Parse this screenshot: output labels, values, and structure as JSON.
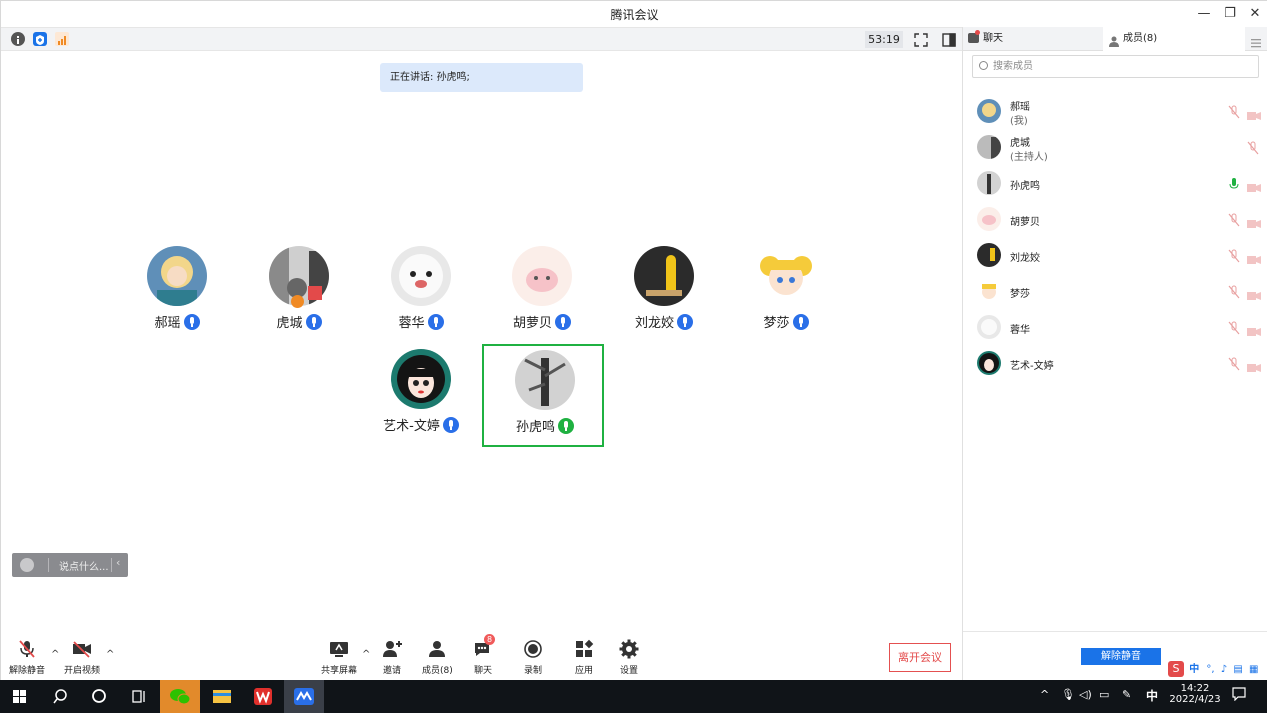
{
  "window": {
    "title": "腾讯会议",
    "controls": [
      "—",
      "❐",
      "✕"
    ]
  },
  "infobar": {
    "timer": "53:19"
  },
  "main": {
    "speaking_text": "正在讲话: 孙虎鸣;",
    "participants": [
      {
        "name": "郝瑶",
        "mic": "active"
      },
      {
        "name": "虎城",
        "mic": "active"
      },
      {
        "name": "蓉华",
        "mic": "active"
      },
      {
        "name": "胡萝贝",
        "mic": "active"
      },
      {
        "name": "刘龙姣",
        "mic": "active"
      },
      {
        "name": "梦莎",
        "mic": "active"
      },
      {
        "name": "艺术-文婷",
        "mic": "active"
      },
      {
        "name": "孙虎鸣",
        "mic": "speaking"
      }
    ],
    "chat_placeholder": "说点什么..."
  },
  "toolbar": {
    "unmute_label": "解除静音",
    "video_label": "开启视频",
    "share_label": "共享屏幕",
    "invite_label": "邀请",
    "members_label": "成员(8)",
    "chat_label": "聊天",
    "chat_badge": "8",
    "record_label": "录制",
    "apps_label": "应用",
    "settings_label": "设置",
    "leave_label": "离开会议"
  },
  "sidebar": {
    "tab_chat": "聊天",
    "tab_members": "成员(8)",
    "search_placeholder": "搜索成员",
    "members": [
      {
        "name": "郝瑶",
        "role": "(我)",
        "audio": "muted",
        "video": "off"
      },
      {
        "name": "虎城",
        "role": "(主持人)",
        "audio": "muted",
        "video": "none"
      },
      {
        "name": "孙虎鸣",
        "role": "",
        "audio": "speaking",
        "video": "off"
      },
      {
        "name": "胡萝贝",
        "role": "",
        "audio": "muted",
        "video": "off"
      },
      {
        "name": "刘龙姣",
        "role": "",
        "audio": "muted",
        "video": "off"
      },
      {
        "name": "梦莎",
        "role": "",
        "audio": "muted",
        "video": "off"
      },
      {
        "name": "蓉华",
        "role": "",
        "audio": "muted",
        "video": "off"
      },
      {
        "name": "艺术-文婷",
        "role": "",
        "audio": "muted",
        "video": "off"
      }
    ],
    "unmute_all_label": "解除静音",
    "ime_text": "中"
  },
  "taskbar": {
    "time": "14:22",
    "date": "2022/4/23",
    "ime": "中"
  },
  "colors": {
    "accent": "#1a73e8",
    "speaking": "#1fb141",
    "danger": "#e34a4a"
  }
}
